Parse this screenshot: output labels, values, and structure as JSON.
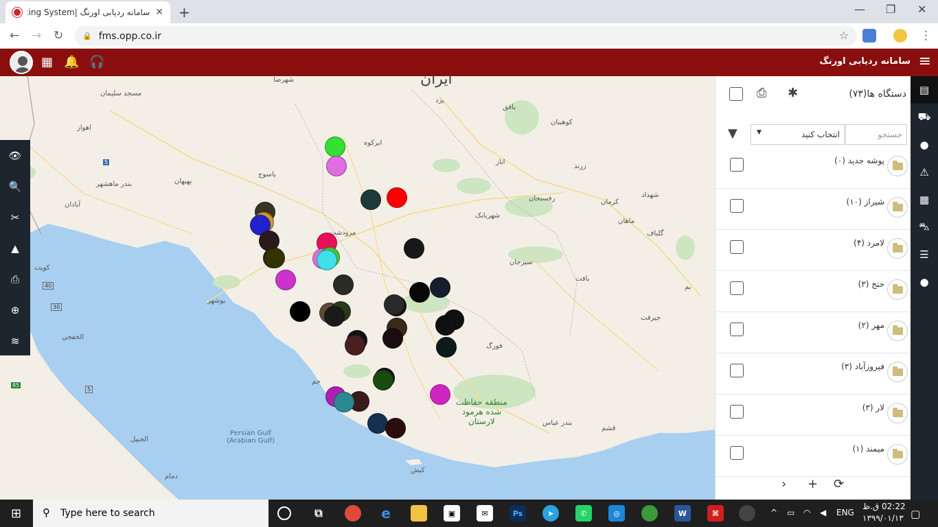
{
  "browser": {
    "tab_title": "سامانه ردیابی اورنگ |Tracking System",
    "url": "fms.opp.co.ir",
    "new_tab": "+",
    "win_minimize": "—",
    "win_restore": "❐",
    "win_close": "✕"
  },
  "header": {
    "brand": "سامانه ردیابی اورنگ",
    "menu_icon": "hamburger-icon",
    "icons": [
      "user-avatar",
      "apps-grid-icon",
      "bell-icon",
      "headset-icon"
    ]
  },
  "map": {
    "labels": {
      "iran": "ایران",
      "yazd": "یزد",
      "ahvaz": "اهواز",
      "abadan": "آبادان",
      "kuwait": "کویت",
      "bushehr": "بوشهر",
      "khafji": "الخفجي",
      "jubail": "الجبیل",
      "dammam": "دمام",
      "kerman": "کرمان",
      "sirjan": "سیرجان",
      "rafsanjan": "رفسنجان",
      "shahrebabak": "شهربابک",
      "bam": "بم",
      "jiroft": "جیرفت",
      "baft": "بافت",
      "bandarabbas": "بندر عباس",
      "qeshm": "قشم",
      "kish": "کیش",
      "fasa": "فورگ",
      "yasuj": "یاسوج",
      "marvdasht": "مرودشت",
      "abarkuh": "ابرکوه",
      "shahreza": "شهرضا",
      "bandar_mahshahr": "بندر ماهشهر",
      "behbahan": "بهبهان",
      "masjed": "مسجد سلیمان",
      "zarand": "زرند",
      "kuhbanan": "کوهبنان",
      "shahdad": "شهداد",
      "mahan": "ماهان",
      "golbaf": "گلباف",
      "anar": "انار",
      "bafgh": "بافق",
      "jam": "جم",
      "persian_gulf": "Persian Gulf\n(Arabian Gulf)",
      "park": "منطقه حفاظت\nشده هرمود\nلارستان",
      "road_5a": "5",
      "road_5b": "5",
      "road_30": "30",
      "road_40": "40",
      "road_85": "85"
    },
    "tool_icons": [
      "eye-icon",
      "zoom-search-icon",
      "tools-icon",
      "shapes-icon",
      "print-icon",
      "zoom-in-icon",
      "layers-icon"
    ],
    "markers": [
      {
        "color": "#33e033"
      },
      {
        "color": "#e06ee0"
      },
      {
        "color": "#ff0000"
      },
      {
        "color": "#1f3a3a"
      },
      {
        "color": "#3a3326"
      },
      {
        "color": "#c79a2a"
      },
      {
        "color": "#2222cc"
      },
      {
        "color": "#2a1a1a"
      },
      {
        "color": "#e8105a"
      },
      {
        "color": "#e070e0"
      },
      {
        "color": "#3a2020"
      },
      {
        "color": "#333300"
      },
      {
        "color": "#44c630"
      },
      {
        "color": "#40e0e8"
      },
      {
        "color": "#2a2a26"
      },
      {
        "color": "#cc33cc"
      },
      {
        "color": "#181818"
      },
      {
        "color": "#000000"
      },
      {
        "color": "#5a4a3a"
      },
      {
        "color": "#2a3a1a"
      },
      {
        "color": "#1a1a1a"
      },
      {
        "color": "#151e2e"
      },
      {
        "color": "#080808"
      },
      {
        "color": "#1a1010"
      },
      {
        "color": "#2a2a2a"
      },
      {
        "color": "#3a2a18"
      },
      {
        "color": "#111"
      },
      {
        "color": "#1a0d12"
      },
      {
        "color": "#101010"
      },
      {
        "color": "#0c1a1a"
      },
      {
        "color": "#12121a"
      },
      {
        "color": "#4a1f1f"
      },
      {
        "color": "#111"
      },
      {
        "color": "#1a4a10"
      },
      {
        "color": "#b020b0"
      },
      {
        "color": "#3a1a1a"
      },
      {
        "color": "#2a8a90"
      },
      {
        "color": "#d025c0"
      },
      {
        "color": "#153050"
      },
      {
        "color": "#2a0e0e"
      }
    ]
  },
  "panel": {
    "title": "دستگاه ها(۷۳)",
    "search_placeholder": "جستجو",
    "select_value": "انتخاب کنید",
    "groups": [
      {
        "name": "پوشه جدید (۰)"
      },
      {
        "name": "شیراز (۱۰)"
      },
      {
        "name": "لامرد (۴)"
      },
      {
        "name": "خنج (۳)"
      },
      {
        "name": "مهر (۲)"
      },
      {
        "name": "فیروزآباد (۳)"
      },
      {
        "name": "لار (۳)"
      },
      {
        "name": "میمند (۱)"
      }
    ],
    "footer": {
      "next": "›",
      "add": "+",
      "refresh": "⟳"
    }
  },
  "side_nav": [
    "map-icon",
    "car-road-icon",
    "location-pin-icon",
    "warning-icon",
    "calendar-icon",
    "car-icon",
    "list-icon",
    "user-icon"
  ],
  "taskbar": {
    "search_text": "Type here to search",
    "lang": "ENG",
    "time": "02:22 ق.ظ",
    "date": "۱۳۹۹/۰۱/۱۳"
  }
}
